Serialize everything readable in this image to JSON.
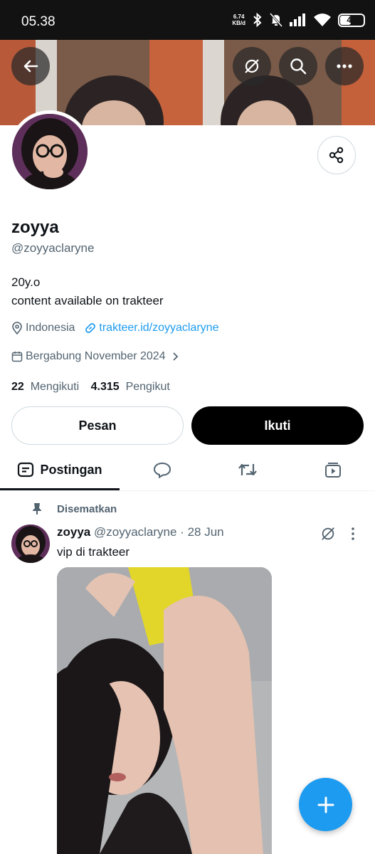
{
  "status_bar": {
    "time": "05.38",
    "net_speed_value": "6.74",
    "net_speed_unit": "KB/d",
    "battery_level": "46",
    "battery_fraction": 0.46
  },
  "banner": {
    "icons": [
      "back-arrow-icon",
      "grok-icon",
      "search-icon",
      "more-icon"
    ]
  },
  "profile": {
    "name": "zoyya",
    "handle": "@zoyyaclaryne",
    "bio_line1": "20y.o",
    "bio_line2": "content available on trakteer",
    "location": "Indonesia",
    "link": "trakteer.id/zoyyaclaryne",
    "joined": "Bergabung November 2024",
    "following_count": "22",
    "following_label": "Mengikuti",
    "followers_count": "4.315",
    "followers_label": "Pengikut"
  },
  "actions": {
    "message_label": "Pesan",
    "follow_label": "Ikuti"
  },
  "tabs": [
    {
      "label": "Postingan",
      "icon": "posts-icon",
      "active": true
    },
    {
      "label": "",
      "icon": "replies-icon"
    },
    {
      "label": "",
      "icon": "reposts-icon"
    },
    {
      "label": "",
      "icon": "media-icon"
    }
  ],
  "pinned_post": {
    "pinned_label": "Disematkan",
    "author": "zoyya",
    "handle": "@zoyyaclaryne",
    "separator": "·",
    "date": "28 Jun",
    "text": "vip di trakteer"
  },
  "colors": {
    "accent": "#1d9bf0",
    "text_primary": "#0f1419",
    "text_secondary": "#536471",
    "follow_button": "#000000",
    "status_bar": "#121212"
  }
}
